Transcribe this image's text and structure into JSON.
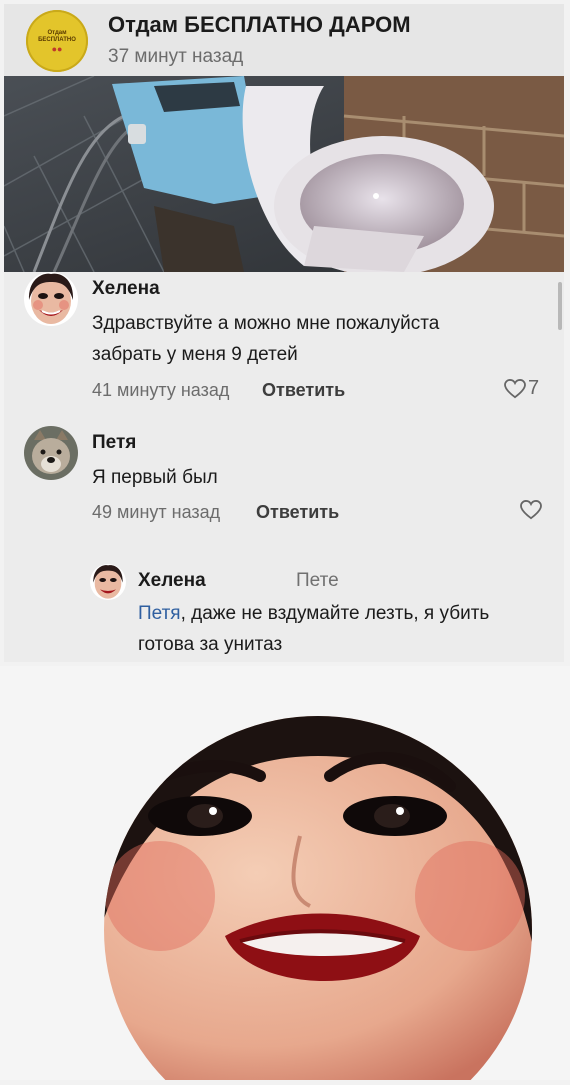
{
  "post": {
    "group_name": "Отдам БЕСПЛАТНО ДАРОМ",
    "time": "37 минут назад",
    "group_avatar_line1": "Отдам",
    "group_avatar_line2": "БЕСПЛАТНО"
  },
  "comments": [
    {
      "author": "Хелена",
      "text_line1": "Здравствуйте а можно мне пожалуйста",
      "text_line2": "забрать у меня 9 детей",
      "time": "41 минуту назад",
      "reply_label": "Ответить",
      "likes": "7"
    },
    {
      "author": "Петя",
      "text": "Я первый был",
      "time": "49 минут назад",
      "reply_label": "Ответить",
      "likes": ""
    }
  ],
  "reply": {
    "author": "Хелена",
    "to": "Пете",
    "mention": "Петя",
    "text_line1_rest": ", даже не вздумайте лезть, я убить",
    "text_line2": "готова за унитаз"
  },
  "icons": {
    "like": "heart-icon"
  },
  "colors": {
    "mention": "#2f5fa0",
    "group_avatar": "#e3c52b"
  }
}
